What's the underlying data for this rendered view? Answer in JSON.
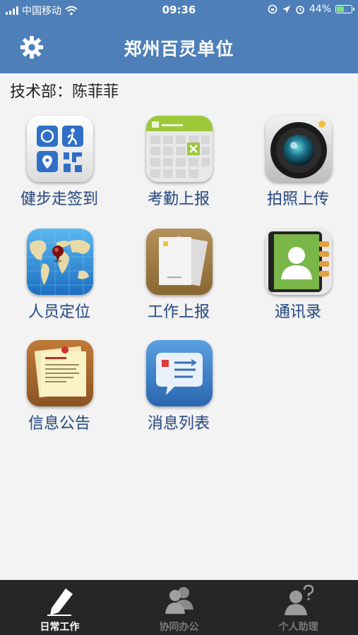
{
  "status_bar": {
    "carrier": "中国移动",
    "time": "09:36",
    "battery": "44%",
    "battery_level": 0.44
  },
  "header": {
    "title": "郑州百灵单位",
    "settings_icon": "gear-icon"
  },
  "user_info": {
    "text": "技术部：陈菲菲"
  },
  "modules": [
    {
      "label": "健步走签到",
      "icon": "walk-checkin-icon"
    },
    {
      "label": "考勤上报",
      "icon": "attendance-calendar-icon"
    },
    {
      "label": "拍照上传",
      "icon": "camera-icon"
    },
    {
      "label": "人员定位",
      "icon": "world-map-pin-icon"
    },
    {
      "label": "工作上报",
      "icon": "documents-icon"
    },
    {
      "label": "通讯录",
      "icon": "contacts-book-icon"
    },
    {
      "label": "信息公告",
      "icon": "notice-board-icon"
    },
    {
      "label": "消息列表",
      "icon": "message-list-icon"
    }
  ],
  "tabs": [
    {
      "label": "日常工作",
      "icon": "pen-icon",
      "active": true
    },
    {
      "label": "协同办公",
      "icon": "people-icon",
      "active": false
    },
    {
      "label": "个人助理",
      "icon": "assistant-question-icon",
      "active": false
    }
  ],
  "colors": {
    "brand": "#4e7fb8",
    "label_text": "#2c4f86",
    "tab_bar": "#262626"
  }
}
